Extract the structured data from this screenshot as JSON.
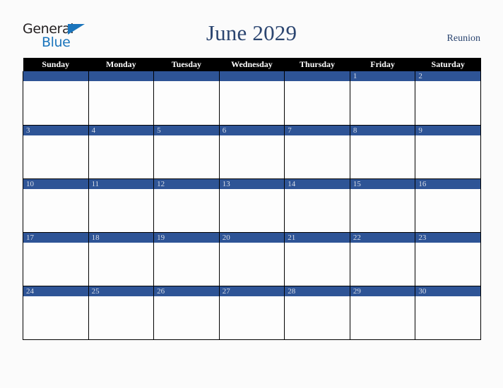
{
  "brand": {
    "name_top": "General",
    "name_bottom": "Blue",
    "triangle_icon": "blue-triangle-icon",
    "color_dark": "#231f20",
    "color_blue": "#1b75bc"
  },
  "header": {
    "title": "June 2029",
    "country": "Reunion",
    "title_color": "#2b4570"
  },
  "theme": {
    "header_row_bg": "#000000",
    "header_row_text": "#ffffff",
    "date_band_bg": "#2e5496",
    "date_band_text": "#d8dde8",
    "cell_bg": "#fdfdfd",
    "page_bg": "#fbfbfb",
    "border": "#000000"
  },
  "calendar": {
    "month": "June",
    "year": "2029",
    "weekday_headers": [
      "Sunday",
      "Monday",
      "Tuesday",
      "Wednesday",
      "Thursday",
      "Friday",
      "Saturday"
    ],
    "weeks": [
      [
        "",
        "",
        "",
        "",
        "",
        "1",
        "2"
      ],
      [
        "3",
        "4",
        "5",
        "6",
        "7",
        "8",
        "9"
      ],
      [
        "10",
        "11",
        "12",
        "13",
        "14",
        "15",
        "16"
      ],
      [
        "17",
        "18",
        "19",
        "20",
        "21",
        "22",
        "23"
      ],
      [
        "24",
        "25",
        "26",
        "27",
        "28",
        "29",
        "30"
      ]
    ]
  }
}
